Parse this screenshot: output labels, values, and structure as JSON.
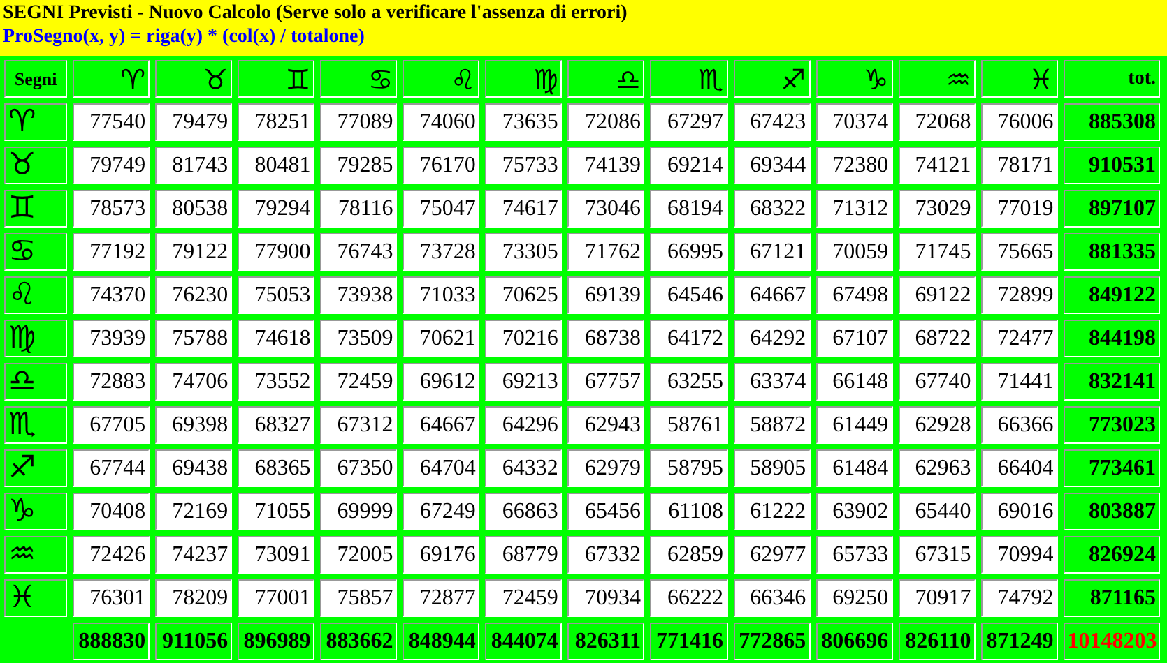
{
  "header": {
    "title": "SEGNI Previsti - Nuovo Calcolo (Serve solo a verificare l'assenza di errori)",
    "formula": "ProSegno(x, y) = riga(y) * (col(x) / totalone)"
  },
  "table": {
    "columns": [
      "Segni",
      "♈",
      "♉",
      "♊",
      "♋",
      "♌",
      "♍",
      "♎",
      "♏",
      "♐",
      "♑",
      "♒",
      "♓",
      "tot."
    ],
    "rows": [
      {
        "sign": "♈",
        "values": [
          "77540",
          "79479",
          "78251",
          "77089",
          "74060",
          "73635",
          "72086",
          "67297",
          "67423",
          "70374",
          "72068",
          "76006"
        ],
        "total": "885308"
      },
      {
        "sign": "♉",
        "values": [
          "79749",
          "81743",
          "80481",
          "79285",
          "76170",
          "75733",
          "74139",
          "69214",
          "69344",
          "72380",
          "74121",
          "78171"
        ],
        "total": "910531"
      },
      {
        "sign": "♊",
        "values": [
          "78573",
          "80538",
          "79294",
          "78116",
          "75047",
          "74617",
          "73046",
          "68194",
          "68322",
          "71312",
          "73029",
          "77019"
        ],
        "total": "897107"
      },
      {
        "sign": "♋",
        "values": [
          "77192",
          "79122",
          "77900",
          "76743",
          "73728",
          "73305",
          "71762",
          "66995",
          "67121",
          "70059",
          "71745",
          "75665"
        ],
        "total": "881335"
      },
      {
        "sign": "♌",
        "values": [
          "74370",
          "76230",
          "75053",
          "73938",
          "71033",
          "70625",
          "69139",
          "64546",
          "64667",
          "67498",
          "69122",
          "72899"
        ],
        "total": "849122"
      },
      {
        "sign": "♍",
        "values": [
          "73939",
          "75788",
          "74618",
          "73509",
          "70621",
          "70216",
          "68738",
          "64172",
          "64292",
          "67107",
          "68722",
          "72477"
        ],
        "total": "844198"
      },
      {
        "sign": "♎",
        "values": [
          "72883",
          "74706",
          "73552",
          "72459",
          "69612",
          "69213",
          "67757",
          "63255",
          "63374",
          "66148",
          "67740",
          "71441"
        ],
        "total": "832141"
      },
      {
        "sign": "♏",
        "values": [
          "67705",
          "69398",
          "68327",
          "67312",
          "64667",
          "64296",
          "62943",
          "58761",
          "58872",
          "61449",
          "62928",
          "66366"
        ],
        "total": "773023"
      },
      {
        "sign": "♐",
        "values": [
          "67744",
          "69438",
          "68365",
          "67350",
          "64704",
          "64332",
          "62979",
          "58795",
          "58905",
          "61484",
          "62963",
          "66404"
        ],
        "total": "773461"
      },
      {
        "sign": "♑",
        "values": [
          "70408",
          "72169",
          "71055",
          "69999",
          "67249",
          "66863",
          "65456",
          "61108",
          "61222",
          "63902",
          "65440",
          "69016"
        ],
        "total": "803887"
      },
      {
        "sign": "♒",
        "values": [
          "72426",
          "74237",
          "73091",
          "72005",
          "69176",
          "68779",
          "67332",
          "62859",
          "62977",
          "65733",
          "67315",
          "70994"
        ],
        "total": "826924"
      },
      {
        "sign": "♓",
        "values": [
          "76301",
          "78209",
          "77001",
          "75857",
          "72877",
          "72459",
          "70934",
          "66222",
          "66346",
          "69250",
          "70917",
          "74792"
        ],
        "total": "871165"
      }
    ],
    "totals": [
      "888830",
      "911056",
      "896989",
      "883662",
      "848944",
      "844074",
      "826311",
      "771416",
      "772865",
      "806696",
      "826110",
      "871249"
    ],
    "grand_total": "10148203"
  }
}
